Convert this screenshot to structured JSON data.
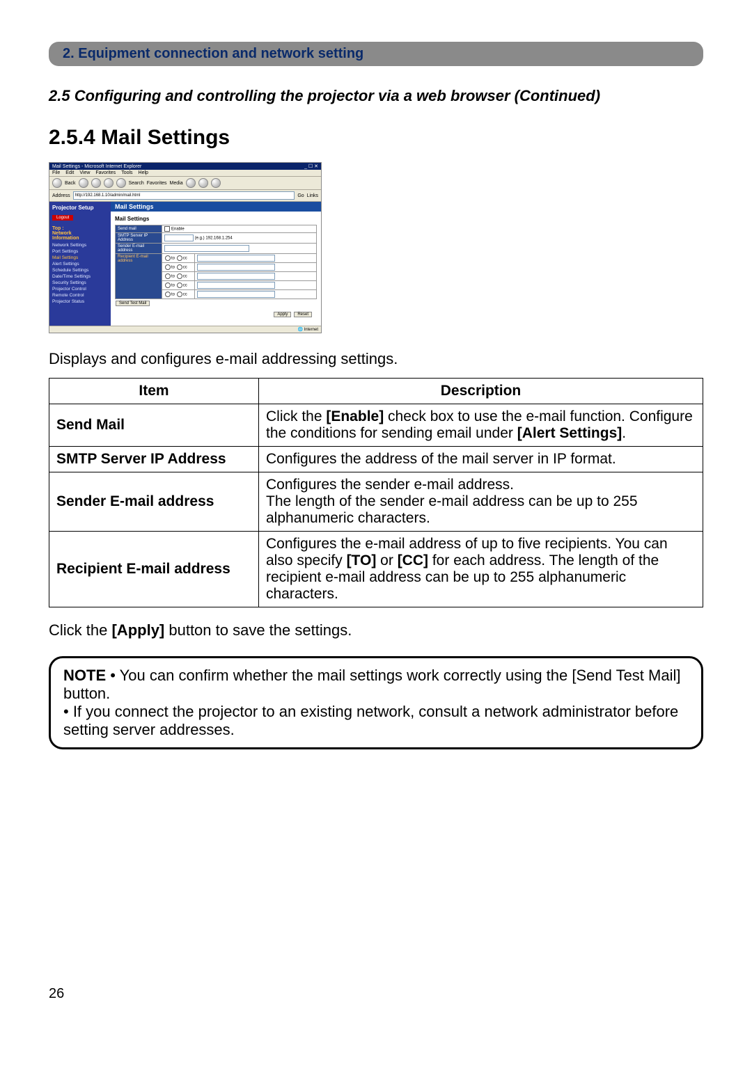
{
  "chapterBar": "2. Equipment connection and network setting",
  "sectionContinued": "2.5 Configuring and controlling the projector via a web browser (Continued)",
  "sectionHeading": "2.5.4 Mail Settings",
  "screenshot": {
    "windowTitle": "Mail Settings - Microsoft Internet Explorer",
    "menus": [
      "File",
      "Edit",
      "View",
      "Favorites",
      "Tools",
      "Help"
    ],
    "toolbarLabels": {
      "back": "Back",
      "search": "Search",
      "favorites": "Favorites",
      "media": "Media"
    },
    "addressLabel": "Address",
    "addressValue": "http://192.168.1.10/admin/mail.html",
    "goLabel": "Go",
    "linksLabel": "Links",
    "sidebarTitle": "Projector Setup",
    "logout": "Logout",
    "topGroup": "Top :\nNetwork\nInformation",
    "sideItems": [
      "Network Settings",
      "Port Settings",
      "Mail Settings",
      "Alert Settings",
      "Schedule Settings",
      "Date/Time Settings",
      "Security Settings",
      "Projector Control",
      "Remote Control",
      "Projector Status"
    ],
    "contentHeader": "Mail Settings",
    "contentTitle": "Mail Settings",
    "rows": {
      "sendMail": "Send mail",
      "enable": "Enable",
      "smtp": "SMTP Server IP Address",
      "smtpHint": "(e.g.) 192.168.1.254",
      "sender": "Sender E-mail address",
      "recip": "Recipient E-mail address",
      "to": "to",
      "cc": "cc"
    },
    "btnSendTest": "Send Test Mail",
    "btnApply": "Apply",
    "btnReset": "Reset",
    "statusText": "Internet"
  },
  "introText": "Displays and configures e-mail addressing settings.",
  "tableHeaders": {
    "item": "Item",
    "desc": "Description"
  },
  "tableRows": [
    {
      "item": "Send Mail",
      "desc_parts": [
        "Click the ",
        "[Enable]",
        " check box to use the e-mail function. Configure the conditions for sending email under ",
        "[Alert Settings]",
        "."
      ]
    },
    {
      "item": "SMTP Server IP Address",
      "desc_parts": [
        "Configures the address of the mail server in IP format."
      ]
    },
    {
      "item": "Sender E-mail address",
      "desc_parts": [
        "Configures the sender e-mail address.\nThe length of the sender e-mail address can be up to 255 alphanumeric characters."
      ]
    },
    {
      "item": "Recipient E-mail address",
      "desc_parts": [
        "Configures the e-mail address of up to five recipients. You can also specify ",
        "[TO]",
        " or ",
        "[CC]",
        " for each address. The length of the recipient e-mail address can be up to 255 alphanumeric characters."
      ]
    }
  ],
  "applyText_parts": [
    "Click the ",
    "[Apply]",
    " button to save the settings."
  ],
  "note": {
    "label": "NOTE",
    "bullet1": " • You can confirm whether the mail settings work correctly using the [Send Test Mail] button.",
    "bullet2": "• If you connect the projector to an existing network, consult a network administrator before setting server addresses."
  },
  "pageNumber": "26"
}
